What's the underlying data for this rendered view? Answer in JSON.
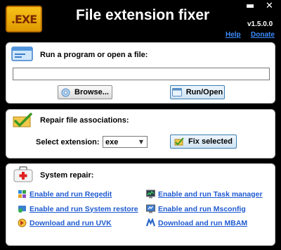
{
  "header": {
    "logo_text": ".EXE",
    "title": "File extension fixer",
    "minimize": "▬",
    "close": "✕",
    "version": "v1.5.0.0",
    "help": "Help",
    "donate": "Donate"
  },
  "run_panel": {
    "heading": "Run a program or open a file:",
    "input_value": "",
    "browse_label": "Browse...",
    "run_label": "Run/Open"
  },
  "repair_panel": {
    "heading": "Repair file associations:",
    "select_label": "Select extension:",
    "selected_extension": "exe",
    "fix_label": "Fix selected"
  },
  "system_panel": {
    "heading": "System repair:",
    "left_links": [
      {
        "label": "Enable and run Regedit",
        "icon": "regedit-icon"
      },
      {
        "label": "Enable and run System restore",
        "icon": "system-restore-icon"
      },
      {
        "label": "Download and run UVK",
        "icon": "uvk-icon"
      }
    ],
    "right_links": [
      {
        "label": "Enable and run Task manager",
        "icon": "task-manager-icon"
      },
      {
        "label": "Enable and run Msconfig",
        "icon": "msconfig-icon"
      },
      {
        "label": "Download and run MBAM",
        "icon": "mbam-icon"
      }
    ]
  }
}
